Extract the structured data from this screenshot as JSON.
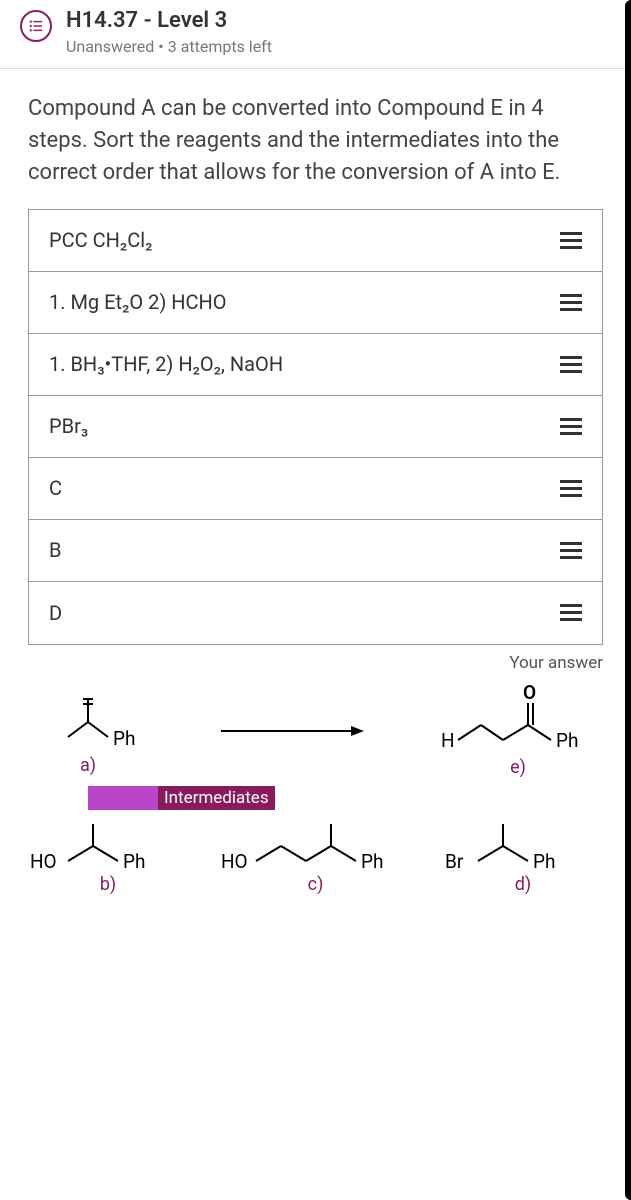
{
  "header": {
    "title": "H14.37 - Level 3",
    "status": "Unanswered",
    "attempts": "3 attempts left"
  },
  "question": "Compound A can be converted into Compound E in 4 steps. Sort the reagents and the intermediates into the correct order that allows for the conversion of A into E.",
  "items": [
    "PCC CH₂Cl₂",
    "1.   Mg Et₂O 2) HCHO",
    "1.   BH₃•THF, 2) H₂O₂, NaOH",
    "PBr₃",
    "C",
    "B",
    "D"
  ],
  "yourAnswer": "Your answer",
  "intermediates": "Intermediates",
  "labels": {
    "a": "a)",
    "b": "b)",
    "c": "c)",
    "d": "d)",
    "e": "e)"
  },
  "atoms": {
    "Ph": "Ph",
    "HO": "HO",
    "H": "H",
    "O": "O",
    "Br": "Br"
  }
}
